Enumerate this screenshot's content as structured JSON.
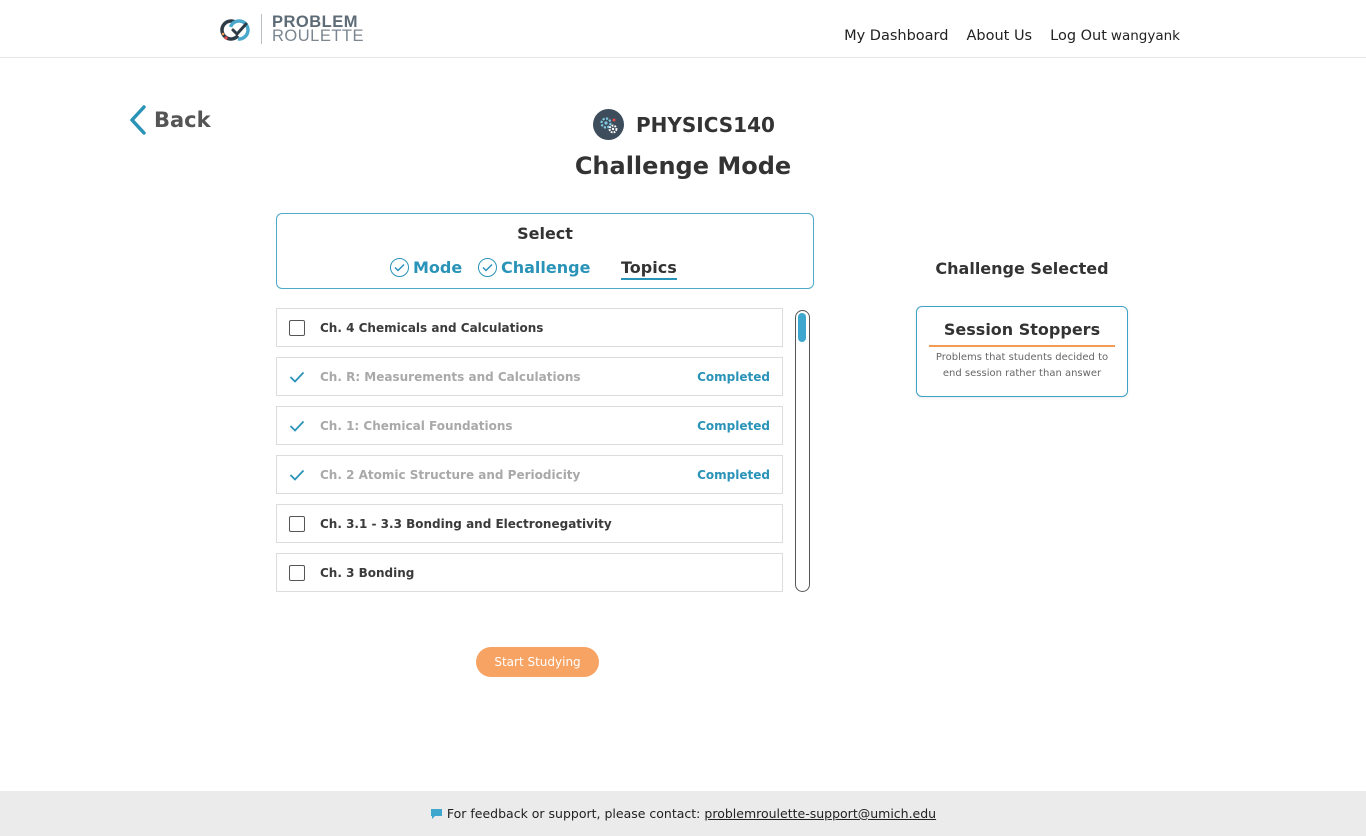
{
  "header": {
    "logo": {
      "line1": "PROBLEM",
      "line2": "ROULETTE"
    },
    "nav": {
      "dashboard": "My Dashboard",
      "about": "About Us",
      "logout": "Log Out",
      "username": "wangyank"
    }
  },
  "back": {
    "label": "Back",
    "icon": "chevron-left-icon"
  },
  "course": {
    "name": "PHYSICS140",
    "icon": "gears-icon"
  },
  "mode_title": "Challenge Mode",
  "select": {
    "title": "Select",
    "steps": [
      {
        "label": "Mode",
        "state": "done"
      },
      {
        "label": "Challenge",
        "state": "done"
      },
      {
        "label": "Topics",
        "state": "current"
      }
    ]
  },
  "topics": [
    {
      "name": "Ch. 4 Chemicals and Calculations",
      "status": ""
    },
    {
      "name": "Ch. R: Measurements and Calculations",
      "status": "Completed"
    },
    {
      "name": "Ch. 1: Chemical Foundations",
      "status": "Completed"
    },
    {
      "name": "Ch. 2 Atomic Structure and Periodicity",
      "status": "Completed"
    },
    {
      "name": "Ch. 3.1 - 3.3 Bonding and Electronegativity",
      "status": ""
    },
    {
      "name": "Ch. 3 Bonding",
      "status": ""
    }
  ],
  "start_button": "Start Studying",
  "challenge_selected": {
    "title": "Challenge Selected",
    "name": "Session Stoppers",
    "description": "Problems that students decided to end session rather than answer"
  },
  "footer": {
    "text": "For feedback or support, please contact:",
    "email": "problemroulette-support@umich.edu"
  },
  "colors": {
    "accent": "#2a93b8",
    "start_button": "#f7a363",
    "underline_orange": "#f39a55",
    "footer_bg": "#ebebeb"
  }
}
